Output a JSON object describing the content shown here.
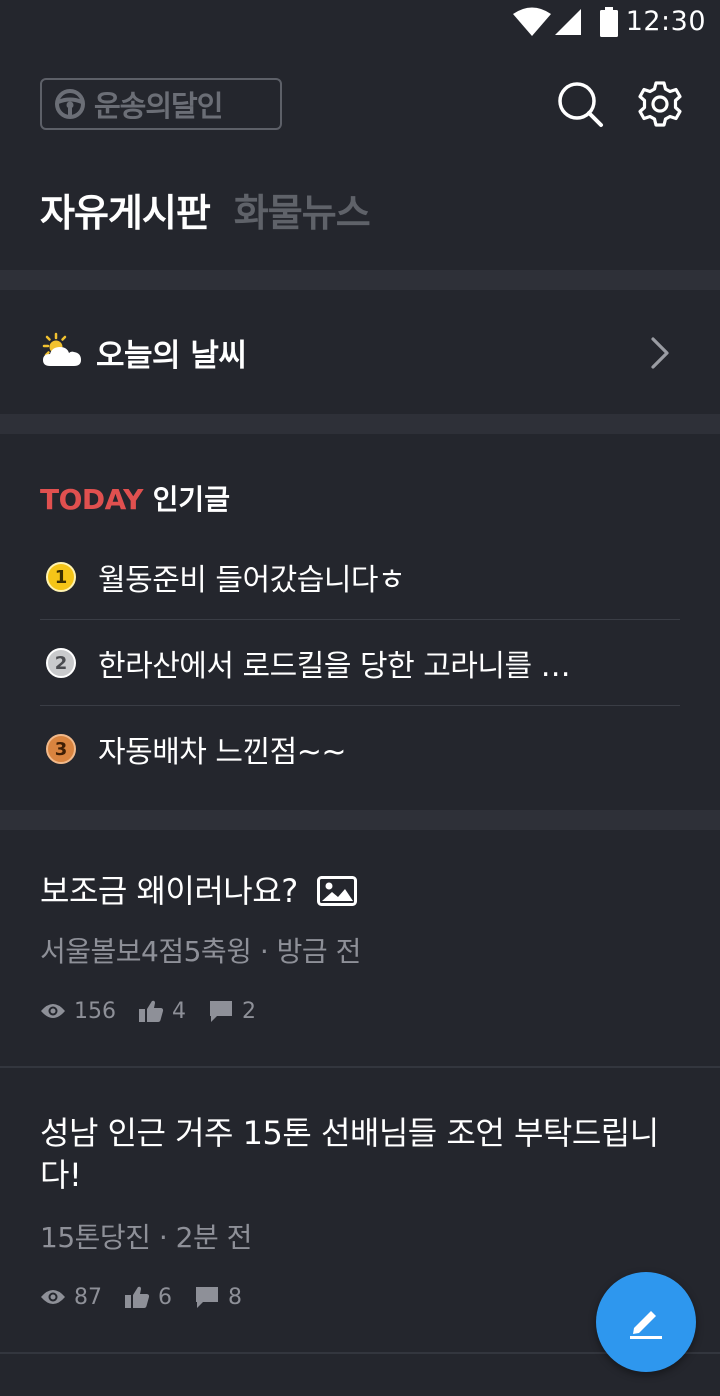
{
  "status_bar": {
    "time": "12:30"
  },
  "header": {
    "logo_text": "운송의달인",
    "search_icon": "search-icon",
    "settings_icon": "gear-icon"
  },
  "tabs": [
    {
      "label": "자유게시판",
      "active": true
    },
    {
      "label": "화물뉴스",
      "active": false
    }
  ],
  "weather": {
    "icon": "partly-sunny-icon",
    "label": "오늘의 날씨"
  },
  "popular": {
    "title_accent": "TODAY",
    "title_rest": "인기글",
    "items": [
      {
        "rank": "1",
        "text": "월동준비 들어갔습니다ㅎ",
        "badge_color": "#f5c518"
      },
      {
        "rank": "2",
        "text": "한라산에서 로드킬을 당한 고라니를 …",
        "badge_color": "#c9cacc"
      },
      {
        "rank": "3",
        "text": "자동배차 느낀점~~",
        "badge_color": "#d9843f"
      }
    ]
  },
  "posts": [
    {
      "title": "보조금 왜이러나요?",
      "has_image": true,
      "author": "서울볼보4점5축윙",
      "time": "방금 전",
      "views": "156",
      "likes": "4",
      "comments": "2"
    },
    {
      "title": "성남 인근 거주 15톤 선배님들 조언 부탁드립니다!",
      "has_image": false,
      "author": "15톤당진",
      "time": "2분 전",
      "views": "87",
      "likes": "6",
      "comments": "8"
    }
  ],
  "fab": {
    "icon": "pencil-icon"
  },
  "colors": {
    "background": "#24262d",
    "section_divider": "#2e3038",
    "accent_red": "#e0504f",
    "fab_blue": "#2e97ee",
    "muted_text": "#8e9098"
  }
}
